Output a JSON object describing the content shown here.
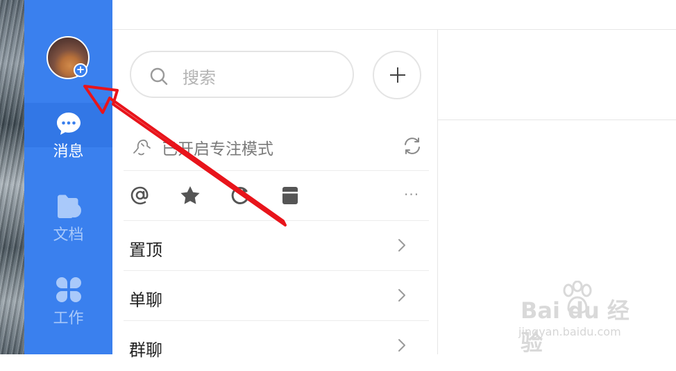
{
  "sidebar": {
    "nav": [
      {
        "label": "消息",
        "icon": "chat-bubble-icon",
        "active": true
      },
      {
        "label": "文档",
        "icon": "folder-doc-icon",
        "active": false
      },
      {
        "label": "工作",
        "icon": "grid-clover-icon",
        "active": false
      }
    ],
    "avatar_badge": "+"
  },
  "search": {
    "placeholder": "搜索"
  },
  "focus_mode": {
    "label": "已开启专注模式"
  },
  "quick_filters": {
    "icons": [
      "at-mention-icon",
      "star-icon",
      "refresh-icon",
      "archive-box-icon"
    ],
    "more": "···"
  },
  "groups": [
    {
      "label": "置顶"
    },
    {
      "label": "单聊"
    },
    {
      "label": "群聊"
    }
  ],
  "watermark": {
    "main": "Bai du 经验",
    "sub": "jingyan.baidu.com"
  },
  "colors": {
    "sidebar": "#3a80ee",
    "annotation_arrow": "#e8141b"
  }
}
